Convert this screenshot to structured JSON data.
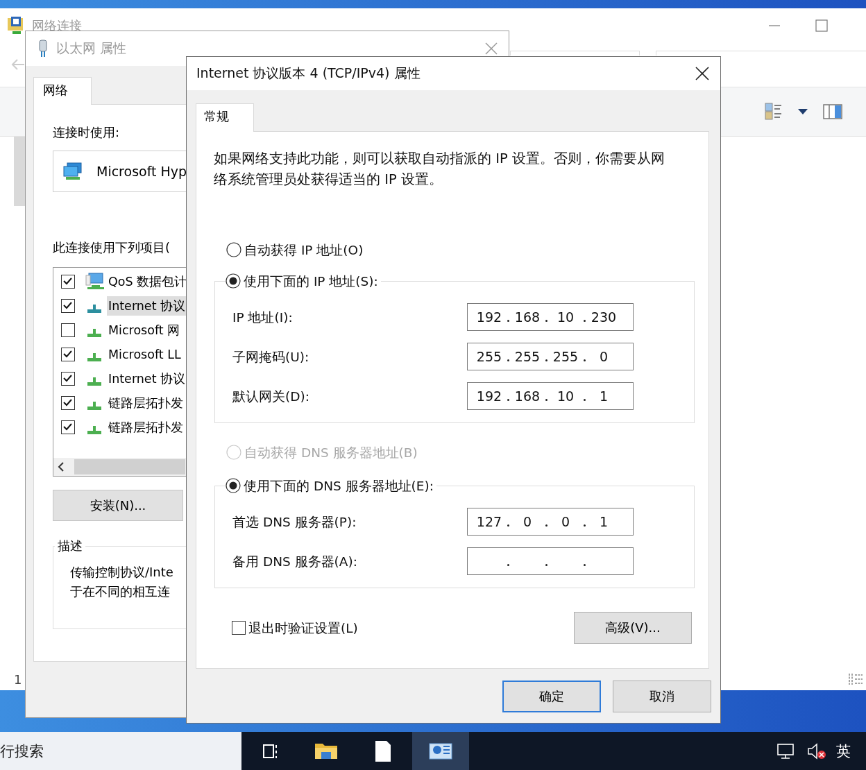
{
  "explorer": {
    "title": "网络连接",
    "item_count": "1"
  },
  "ethernet_dialog": {
    "title": "以太网 属性",
    "tabs": [
      {
        "label": "网络",
        "selected": true
      }
    ],
    "connect_using_label": "连接时使用:",
    "adapter": "Microsoft Hyp",
    "items_label": "此连接使用下列项目(",
    "items": [
      {
        "label": "QoS 数据包计",
        "checked": true,
        "selected": false,
        "kind": "service"
      },
      {
        "label": "Internet 协议",
        "checked": true,
        "selected": true,
        "kind": "protocol"
      },
      {
        "label": "Microsoft 网",
        "checked": false,
        "selected": false,
        "kind": "protocol"
      },
      {
        "label": "Microsoft LL",
        "checked": true,
        "selected": false,
        "kind": "protocol"
      },
      {
        "label": "Internet 协议",
        "checked": true,
        "selected": false,
        "kind": "protocol"
      },
      {
        "label": "链路层拓扑发",
        "checked": true,
        "selected": false,
        "kind": "protocol"
      },
      {
        "label": "链路层拓扑发",
        "checked": true,
        "selected": false,
        "kind": "protocol"
      }
    ],
    "install_button": "安装(N)...",
    "description_title": "描述",
    "description": [
      "传输控制协议/Inte",
      "于在不同的相互连"
    ]
  },
  "ipv4_dialog": {
    "title": "Internet 协议版本 4 (TCP/IPv4) 属性",
    "tabs": [
      {
        "label": "常规",
        "selected": true
      }
    ],
    "intro": "如果网络支持此功能，则可以获取自动指派的 IP 设置。否则，你需要从网络系统管理员处获得适当的 IP 设置。",
    "ip_mode": [
      {
        "label": "自动获得 IP 地址(O)",
        "selected": false
      },
      {
        "label": "使用下面的 IP 地址(S):",
        "selected": true
      }
    ],
    "ip_fields": [
      {
        "label": "IP 地址(I):",
        "octets": [
          "192",
          "168",
          "10",
          "230"
        ]
      },
      {
        "label": "子网掩码(U):",
        "octets": [
          "255",
          "255",
          "255",
          "0"
        ]
      },
      {
        "label": "默认网关(D):",
        "octets": [
          "192",
          "168",
          "10",
          "1"
        ]
      }
    ],
    "dns_mode": [
      {
        "label": "自动获得 DNS 服务器地址(B)",
        "selected": false,
        "disabled": true
      },
      {
        "label": "使用下面的 DNS 服务器地址(E):",
        "selected": true,
        "disabled": false
      }
    ],
    "dns_fields": [
      {
        "label": "首选 DNS 服务器(P):",
        "octets": [
          "127",
          "0",
          "0",
          "1"
        ]
      },
      {
        "label": "备用 DNS 服务器(A):"
      }
    ],
    "validate_on_exit": {
      "label": "退出时验证设置(L)",
      "checked": false
    },
    "advanced_button": "高级(V)...",
    "ok_button": "确定",
    "cancel_button": "取消"
  },
  "taskbar": {
    "search": "行搜索",
    "apps": [
      {
        "kind": "task-view",
        "selected": false
      },
      {
        "kind": "folder",
        "selected": false
      },
      {
        "kind": "document",
        "selected": false
      },
      {
        "kind": "network",
        "selected": true
      }
    ],
    "volume_muted": true,
    "language": "英"
  }
}
